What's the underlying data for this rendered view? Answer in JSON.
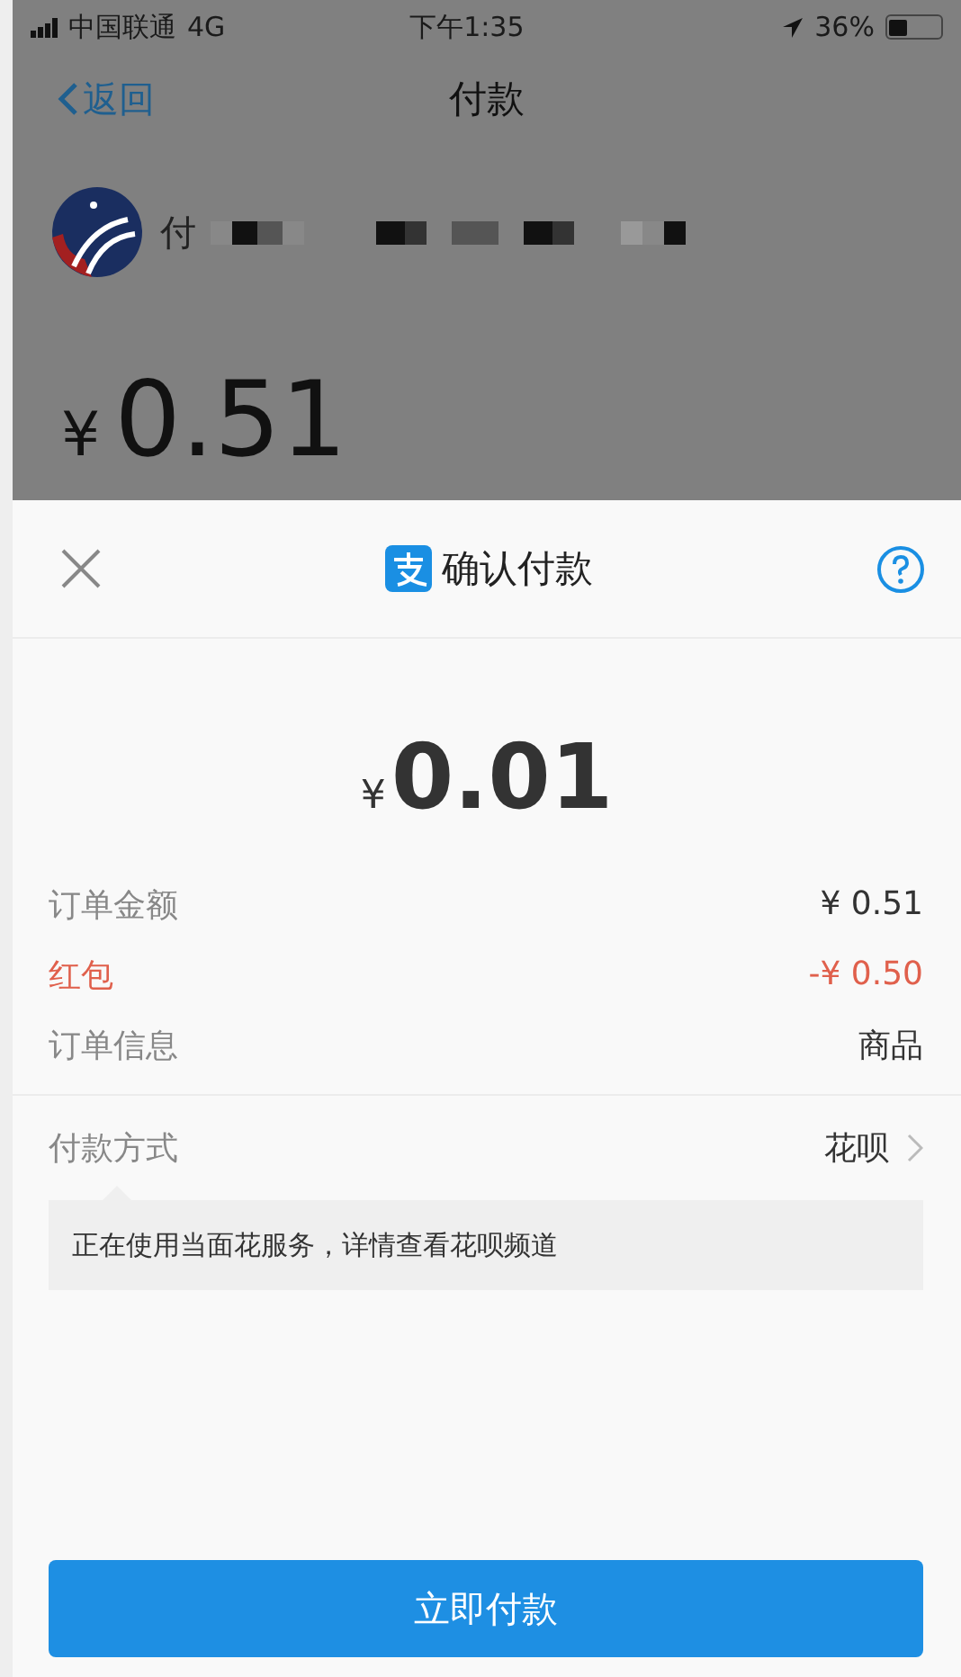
{
  "status_bar": {
    "carrier": "中国联通",
    "network": "4G",
    "time": "下午1:35",
    "battery": "36%"
  },
  "nav": {
    "back": "返回",
    "title": "付款"
  },
  "merchant": {
    "name": "付"
  },
  "background_amount": {
    "currency": "¥",
    "value": "0.51"
  },
  "sheet": {
    "title": "确认付款",
    "currency": "¥",
    "amount": "0.01",
    "rows": [
      {
        "kind": "normal",
        "label": "订单金额",
        "value": "¥ 0.51"
      },
      {
        "kind": "discount",
        "label": "红包",
        "value": "-¥ 0.50"
      },
      {
        "kind": "normal",
        "label": "订单信息",
        "value": "商品"
      }
    ],
    "payment_method": {
      "label": "付款方式",
      "value": "花呗"
    },
    "notice": "正在使用当面花服务，详情查看花呗频道",
    "pay_button": "立即付款"
  }
}
